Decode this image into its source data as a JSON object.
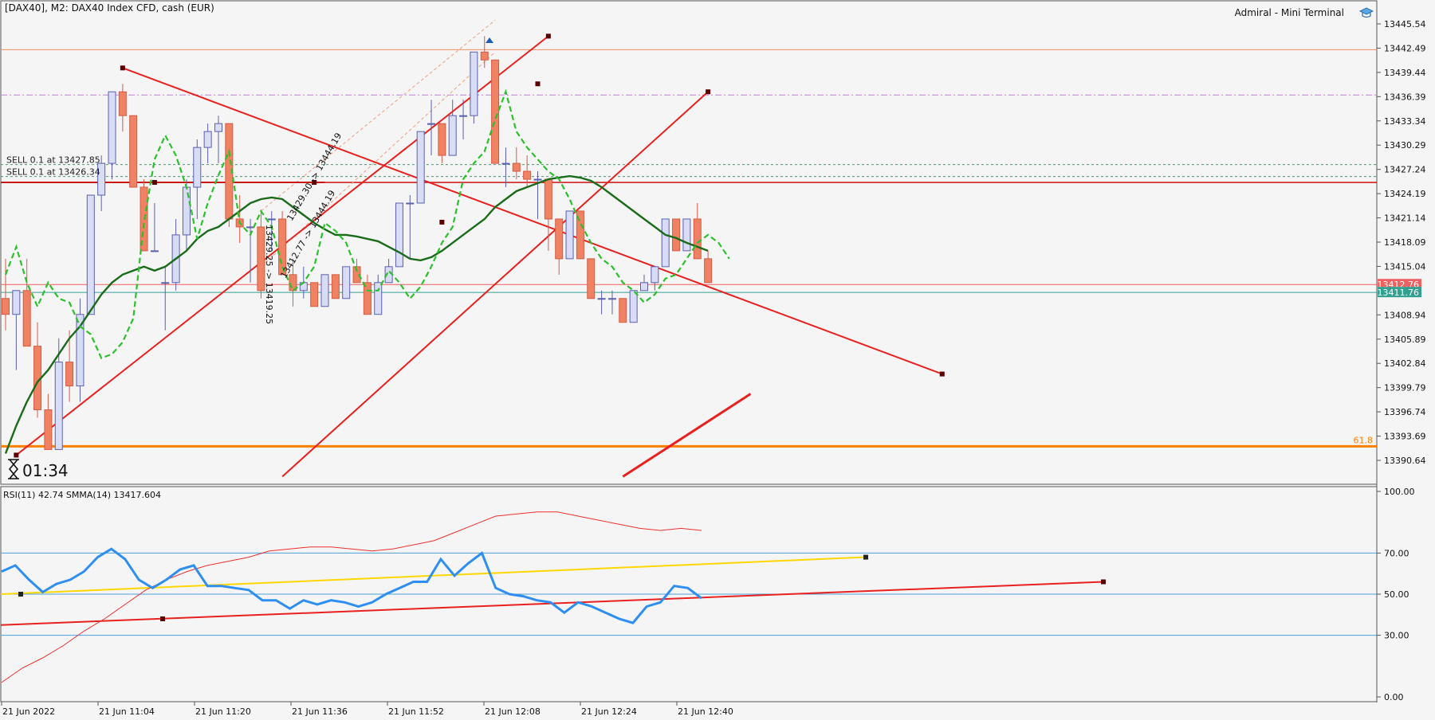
{
  "header": {
    "symbol_info": "[DAX40], M2:  DAX40 Index CFD, cash (EUR)",
    "terminal": "Admiral - Mini Terminal"
  },
  "timer": "01:34",
  "colors": {
    "bull": "#d9dcf5",
    "bear": "#f08264",
    "bear_border": "#d65a44",
    "ma_solid": "#1a6b1a",
    "ma_dashed": "#2cc02c",
    "trend": "#e8201e",
    "fib": "#ff8000",
    "rsi": "#2e8ff0",
    "rsi_smma": "#f03030",
    "rsi_trend_yellow": "#ffd700",
    "grid_blue": "#4a9fd8"
  },
  "chart_data": [
    {
      "type": "candlestick",
      "y_axis_ticks": [
        "13445.54",
        "13442.49",
        "13439.44",
        "13436.39",
        "13433.34",
        "13430.29",
        "13427.24",
        "13424.19",
        "13421.14",
        "13418.09",
        "13415.04",
        "13408.94",
        "13405.89",
        "13402.84",
        "13399.79",
        "13396.74",
        "13393.69",
        "13390.64"
      ],
      "ylim": [
        13388.6,
        13447.6
      ],
      "x_axis_ticks": [
        "21 Jun 2022",
        "21 Jun 11:04",
        "21 Jun 11:20",
        "21 Jun 11:36",
        "21 Jun 11:52",
        "21 Jun 12:08",
        "21 Jun 12:24",
        "21 Jun 12:40"
      ],
      "price_labels": [
        {
          "text": "13412.76",
          "price": 13412.76,
          "color": "#f06060"
        },
        {
          "text": "13411.76",
          "price": 13411.76,
          "color": "#30a090"
        }
      ],
      "fib_label": "61.8",
      "fib_level": 13392.4,
      "order_labels": [
        "SELL 0.1 at 13427.85",
        "SELL 0.1 at 13426.34"
      ],
      "order_levels": [
        13427.85,
        13426.34
      ],
      "hlines": [
        {
          "price": 13442.3,
          "color": "#f08a5d",
          "style": "solid"
        },
        {
          "price": 13436.6,
          "color": "#c080e0",
          "style": "dashdot"
        },
        {
          "price": 13425.6,
          "color": "#d02020",
          "style": "solid"
        }
      ],
      "trade_texts": [
        "13429.30 -> 13444.19",
        "13412.77 -> 13444.19",
        "13429.25 -> 13419.25"
      ],
      "candles": [
        [
          13411,
          13416,
          13407,
          13409
        ],
        [
          13409,
          13412,
          13402,
          13412
        ],
        [
          13412,
          13416,
          13405,
          13405
        ],
        [
          13405,
          13408,
          13396,
          13397
        ],
        [
          13397,
          13399,
          13392,
          13392
        ],
        [
          13392,
          13406,
          13392,
          13403
        ],
        [
          13403,
          13407,
          13398,
          13400
        ],
        [
          13400,
          13411,
          13398,
          13409
        ],
        [
          13409,
          13424,
          13409,
          13424
        ],
        [
          13424,
          13429,
          13422,
          13428
        ],
        [
          13428,
          13437,
          13426,
          13437
        ],
        [
          13437,
          13438,
          13432,
          13434
        ],
        [
          13434,
          13434,
          13425,
          13425
        ],
        [
          13425,
          13426,
          13417,
          13417
        ],
        [
          13417,
          13423,
          13417,
          13417
        ],
        [
          13413,
          13415,
          13407,
          13413
        ],
        [
          13413,
          13421,
          13412,
          13419
        ],
        [
          13419,
          13426,
          13417,
          13425
        ],
        [
          13425,
          13431,
          13421,
          13430
        ],
        [
          13430,
          13433,
          13428,
          13432
        ],
        [
          13432,
          13434,
          13428,
          13433
        ],
        [
          13433,
          13433,
          13420,
          13421
        ],
        [
          13421,
          13424,
          13418,
          13420
        ],
        [
          13420,
          13421,
          13413,
          13420
        ],
        [
          13420,
          13422,
          13411,
          13412
        ],
        [
          13421,
          13422,
          13417,
          13421
        ],
        [
          13421,
          13422,
          13414,
          13414
        ],
        [
          13414,
          13416,
          13410,
          13412
        ],
        [
          13412,
          13415,
          13411,
          13413
        ],
        [
          13413,
          13413,
          13410,
          13410
        ],
        [
          13410,
          13414,
          13410,
          13414
        ],
        [
          13414,
          13414,
          13411,
          13411
        ],
        [
          13411,
          13415,
          13411,
          13415
        ],
        [
          13415,
          13416,
          13413,
          13413
        ],
        [
          13413,
          13414,
          13409,
          13409
        ],
        [
          13409,
          13414,
          13409,
          13413
        ],
        [
          13413,
          13416,
          13413,
          13415
        ],
        [
          13415,
          13423,
          13415,
          13423
        ],
        [
          13423,
          13424,
          13416,
          13423
        ],
        [
          13423,
          13432,
          13423,
          13432
        ],
        [
          13433,
          13436,
          13429,
          13433
        ],
        [
          13433,
          13433,
          13428,
          13429
        ],
        [
          13429,
          13436,
          13429,
          13434
        ],
        [
          13434,
          13436,
          13431,
          13434
        ],
        [
          13434,
          13442,
          13433,
          13442
        ],
        [
          13442,
          13444,
          13440,
          13441
        ],
        [
          13441,
          13441,
          13428,
          13428
        ],
        [
          13428,
          13430,
          13425,
          13428
        ],
        [
          13428,
          13430,
          13426,
          13427
        ],
        [
          13427,
          13429,
          13425,
          13426
        ],
        [
          13426,
          13427,
          13421,
          13426
        ],
        [
          13426,
          13426,
          13417,
          13421
        ],
        [
          13421,
          13421,
          13414,
          13416
        ],
        [
          13416,
          13422,
          13416,
          13422
        ],
        [
          13422,
          13422,
          13416,
          13416
        ],
        [
          13416,
          13416,
          13411,
          13411
        ],
        [
          13411,
          13412,
          13409,
          13411
        ],
        [
          13411,
          13412,
          13409,
          13411
        ],
        [
          13411,
          13411,
          13408,
          13408
        ],
        [
          13408,
          13412,
          13408,
          13412
        ],
        [
          13412,
          13414,
          13412,
          13413
        ],
        [
          13413,
          13415,
          13412,
          13415
        ],
        [
          13415,
          13421,
          13415,
          13421
        ],
        [
          13421,
          13421,
          13417,
          13417
        ],
        [
          13417,
          13421,
          13417,
          13421
        ],
        [
          13421,
          13423,
          13416,
          13416
        ],
        [
          13416,
          13417,
          13413,
          13413
        ]
      ],
      "ma_solid": [
        13391.5,
        13395,
        13398,
        13400.5,
        13402,
        13404,
        13406,
        13407.5,
        13409.5,
        13411.5,
        13413,
        13414,
        13414.5,
        13415,
        13414.5,
        13415,
        13416,
        13417,
        13418.5,
        13419.5,
        13420,
        13421,
        13422,
        13423,
        13423.5,
        13423.7,
        13423.5,
        13422.5,
        13421.5,
        13420.5,
        13419.7,
        13419,
        13419,
        13418.8,
        13418.5,
        13418.2,
        13417.5,
        13416.8,
        13416,
        13415.8,
        13416.2,
        13417,
        13418,
        13419,
        13420,
        13421,
        13422.5,
        13423.5,
        13424.5,
        13425,
        13425.5,
        13426,
        13426.2,
        13426.4,
        13426.2,
        13425.8,
        13425,
        13424,
        13423,
        13422,
        13421,
        13420,
        13419,
        13418.6,
        13418,
        13417.5,
        13417
      ],
      "ma_dashed": [
        13414,
        13417.5,
        13413,
        13410,
        13413,
        13411,
        13410.5,
        13407.5,
        13406.5,
        13403.5,
        13404,
        13405.5,
        13408.5,
        13420.5,
        13428.5,
        13431.5,
        13429,
        13425,
        13418.5,
        13423,
        13426.5,
        13429.5,
        13420.5,
        13419,
        13422,
        13420,
        13415,
        13412,
        13413,
        13415,
        13420.5,
        13419.5,
        13418,
        13414.5,
        13412,
        13412,
        13414.5,
        13413,
        13411,
        13412.5,
        13415,
        13418,
        13420,
        13426,
        13428,
        13429.5,
        13433.5,
        13437,
        13432,
        13430,
        13428.5,
        13427,
        13426,
        13423.5,
        13420.5,
        13418,
        13416,
        13415,
        13413,
        13412,
        13410.5,
        13411.5,
        13413.5,
        13414,
        13416,
        13418,
        13419,
        13418,
        13416
      ],
      "trendlines": [
        {
          "from": [
            1,
            13391.3
          ],
          "to": [
            51,
            13444
          ],
          "color": "#e8201e",
          "width": 2
        },
        {
          "from": [
            11,
            13440
          ],
          "to": [
            88,
            13401.5
          ],
          "color": "#e8201e",
          "width": 2
        },
        {
          "from": [
            26,
            13388.6
          ],
          "to": [
            66,
            13437
          ],
          "color": "#e8201e",
          "width": 2
        },
        {
          "from": [
            58,
            13388.6
          ],
          "to": [
            70,
            13399
          ],
          "color": "#e8201e",
          "width": 3
        }
      ]
    },
    {
      "type": "line",
      "label": "RSI(11) 42.74 SMMA(14) 13417.604",
      "y_axis_ticks": [
        "100.00",
        "70.00",
        "50.00",
        "30.00",
        "0.00"
      ],
      "ylim": [
        0,
        100
      ],
      "levels": [
        70,
        50,
        30
      ],
      "rsi": [
        61,
        64,
        57,
        51,
        55,
        57,
        61,
        68,
        72,
        67,
        57,
        53,
        57,
        62,
        64,
        54,
        54,
        53,
        52,
        47,
        47,
        43,
        47,
        45,
        47,
        46,
        44,
        46,
        50,
        53,
        56,
        56,
        67,
        59,
        65,
        70,
        53,
        50,
        49,
        47,
        46,
        41,
        46,
        44,
        41,
        38,
        36,
        44,
        46,
        54,
        53,
        48
      ],
      "smma": [
        7,
        14,
        19,
        25,
        32,
        38,
        45,
        52,
        57,
        61,
        64,
        66,
        68,
        71,
        72,
        73,
        73,
        72,
        71,
        72,
        74,
        76,
        80,
        84,
        88,
        89,
        90,
        90,
        88,
        86,
        84,
        82,
        81,
        82,
        81
      ]
    }
  ]
}
